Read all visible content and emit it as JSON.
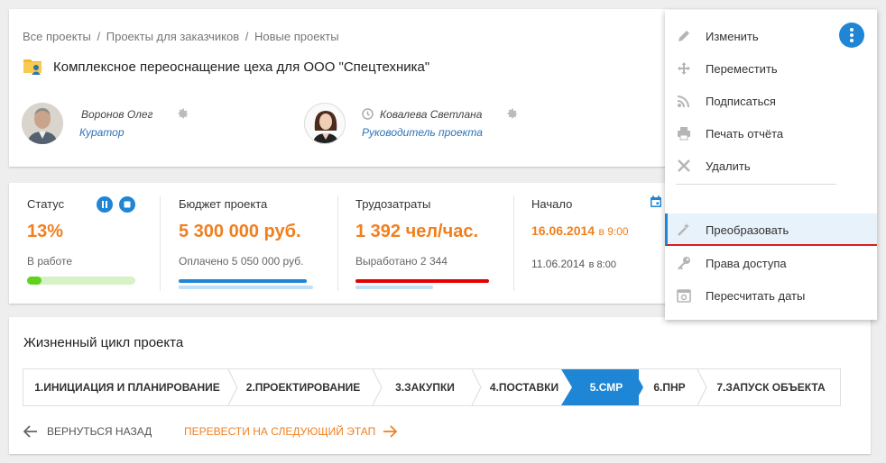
{
  "breadcrumb": {
    "items": [
      "Все проекты",
      "Проекты для заказчиков",
      "Новые проекты"
    ],
    "separator": "/"
  },
  "project": {
    "title": "Комплексное переоснащение цеха для ООО \"Спецтехника\"",
    "icon": "folder-user-icon"
  },
  "people": [
    {
      "name": "Воронов Олег",
      "role": "Куратор",
      "avatar": "avatar-man"
    },
    {
      "name": "Ковалева Светлана",
      "role": "Руководитель проекта",
      "avatar": "avatar-woman",
      "status_icon": "clock-icon"
    }
  ],
  "stats": {
    "status": {
      "label": "Статус",
      "value": "13%",
      "sub": "В работе",
      "progress": 0.13,
      "controls": [
        "pause-icon",
        "stop-icon"
      ]
    },
    "budget": {
      "label": "Бюджет проекта",
      "value": "5 300 000 руб.",
      "sub": "Оплачено 5 050 000 руб.",
      "bar_fill": 0.95,
      "bar_color": "#1f86d6",
      "track_color": "#bfe0f6"
    },
    "labor": {
      "label": "Трудозатраты",
      "value": "1 392 чел/час.",
      "sub": "Выработано 2 344",
      "bar_fill": 1.0,
      "bar_color": "#e60000",
      "track_color": "#bfe0f6"
    },
    "start": {
      "label": "Начало",
      "planned_date": "16.06.2014",
      "planned_time": "в 9:00",
      "actual_date": "11.06.2014",
      "actual_time": "в 8:00",
      "icon": "calendar-icon"
    }
  },
  "lifecycle": {
    "title": "Жизненный цикл проекта",
    "steps": [
      {
        "label": "1.ИНИЦИАЦИЯ И ПЛАНИРОВАНИЕ",
        "active": false
      },
      {
        "label": "2.ПРОЕКТИРОВАНИЕ",
        "active": false
      },
      {
        "label": "3.ЗАКУПКИ",
        "active": false
      },
      {
        "label": "4.ПОСТАВКИ",
        "active": false
      },
      {
        "label": "5.СМР",
        "active": true
      },
      {
        "label": "6.ПНР",
        "active": false
      },
      {
        "label": "7.ЗАПУСК ОБЪЕКТА",
        "active": false
      }
    ],
    "back_label": "ВЕРНУТЬСЯ НАЗАД",
    "next_label": "ПЕРЕВЕСТИ НА СЛЕДУЮЩИЙ ЭТАП"
  },
  "menu": {
    "items": [
      {
        "label": "Изменить",
        "icon": "pencil-icon"
      },
      {
        "label": "Переместить",
        "icon": "move-icon"
      },
      {
        "label": "Подписаться",
        "icon": "rss-icon"
      },
      {
        "label": "Печать отчёта",
        "icon": "printer-icon"
      },
      {
        "label": "Удалить",
        "icon": "close-icon"
      },
      {
        "label": "Преобразовать",
        "icon": "magic-wand-icon",
        "highlighted": true
      },
      {
        "label": "Права доступа",
        "icon": "key-icon"
      },
      {
        "label": "Пересчитать даты",
        "icon": "calendar-refresh-icon"
      }
    ]
  },
  "colors": {
    "accent": "#1f86d6",
    "orange": "#f07f1e",
    "green": "#5fd11e",
    "red": "#e60000"
  }
}
